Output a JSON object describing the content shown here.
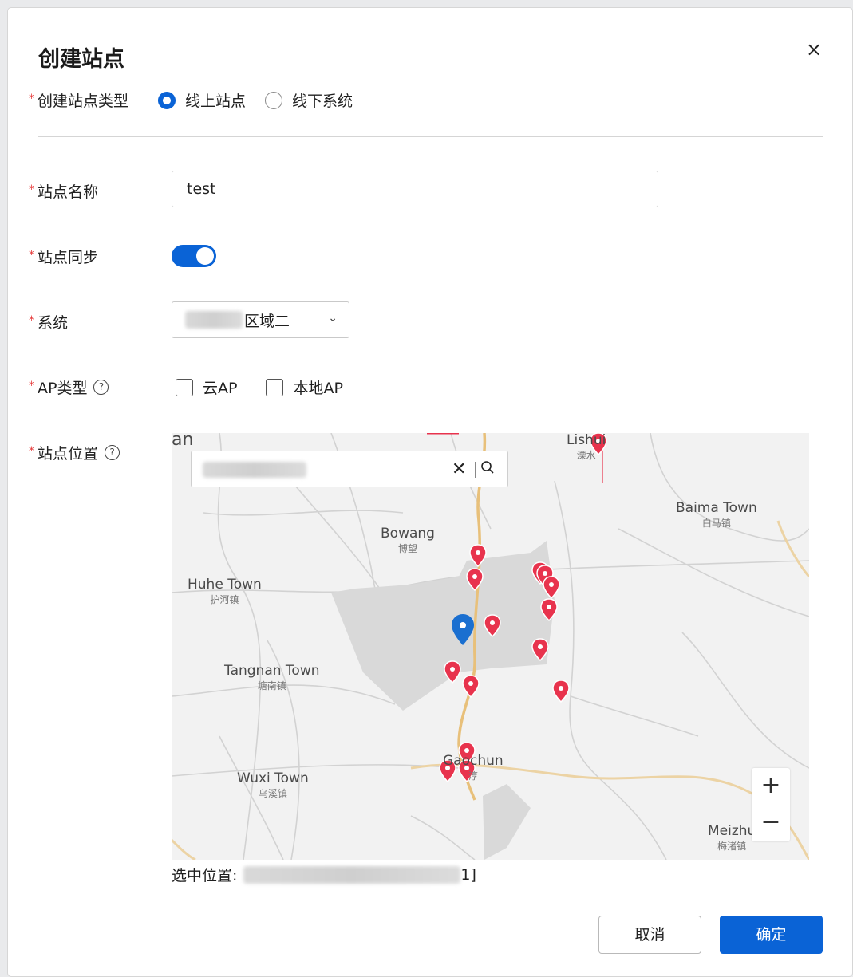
{
  "dialog": {
    "title": "创建站点",
    "close": "×"
  },
  "form": {
    "site_type": {
      "label": "创建站点类型",
      "options": [
        "线上站点",
        "线下系统"
      ],
      "selected": "线上站点"
    },
    "site_name": {
      "label": "站点名称",
      "value": "test"
    },
    "site_sync": {
      "label": "站点同步",
      "enabled": true
    },
    "system": {
      "label": "系统",
      "value": "区域二"
    },
    "ap_type": {
      "label": "AP类型",
      "help": "?",
      "options": [
        "云AP",
        "本地AP"
      ]
    },
    "site_location": {
      "label": "站点位置",
      "help": "?"
    },
    "selected_location": {
      "label": "选中位置:",
      "suffix": "1]"
    }
  },
  "map": {
    "search_clear": "✕",
    "search_icon": "⌕",
    "zoom_in": "+",
    "zoom_out": "−",
    "places": [
      {
        "en": "Lishui",
        "cn": "溧水"
      },
      {
        "en": "Baima Town",
        "cn": "白马镇"
      },
      {
        "en": "Bowang",
        "cn": "博望"
      },
      {
        "en": "Huhe Town",
        "cn": "护河镇"
      },
      {
        "en": "Tangnan Town",
        "cn": "塘南镇"
      },
      {
        "en": "Gaochun",
        "cn": "淳"
      },
      {
        "en": "Wuxi Town",
        "cn": "乌溪镇"
      },
      {
        "en": "Meizhu",
        "cn": "梅渚镇"
      },
      {
        "en": "an",
        "cn": ""
      }
    ],
    "pin_color": "#e8334d",
    "selected_pin_color": "#1a6fd0"
  },
  "footer": {
    "cancel": "取消",
    "confirm": "确定"
  },
  "colors": {
    "primary": "#0a63d6",
    "required": "#e63b3b"
  }
}
